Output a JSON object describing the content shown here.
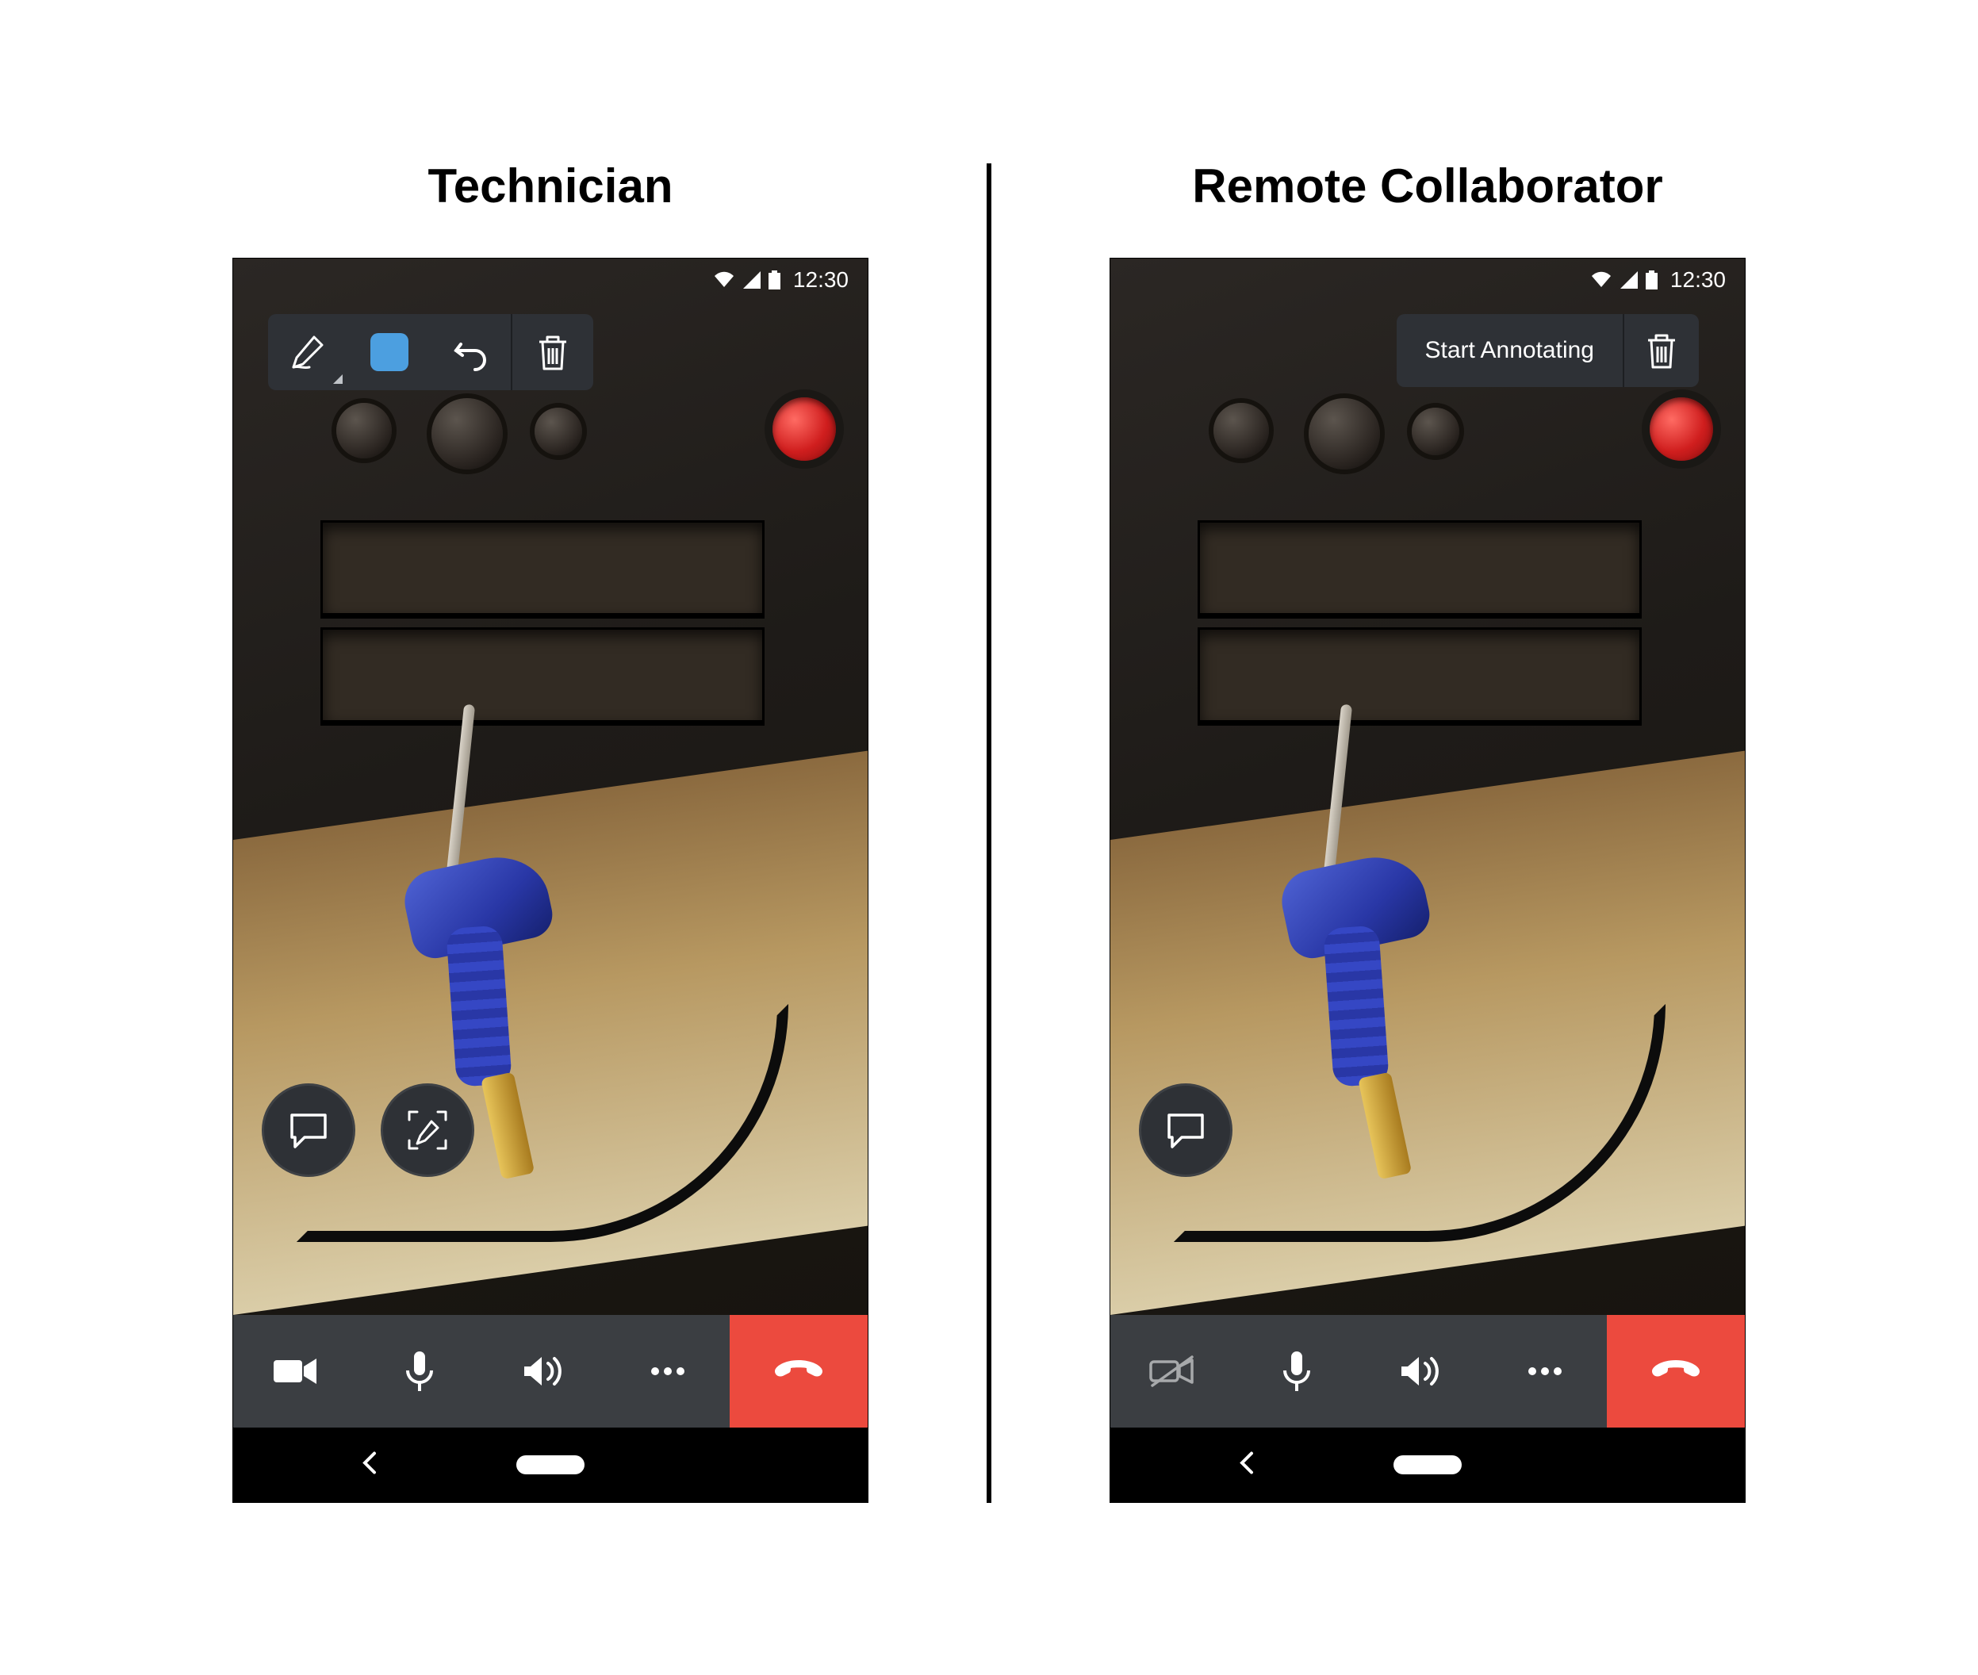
{
  "panels": {
    "technician": {
      "title": "Technician"
    },
    "collaborator": {
      "title": "Remote Collaborator"
    }
  },
  "status": {
    "time": "12:30"
  },
  "collaborator_toolbar": {
    "start_annotating": "Start Annotating"
  },
  "icons": {
    "pen": "pen-icon",
    "color": "color-picker-icon",
    "undo": "undo-icon",
    "trash": "trash-icon",
    "chat": "chat-icon",
    "annotate_view": "annotate-view-icon",
    "camera_on": "video-on-icon",
    "camera_off": "video-off-icon",
    "mic": "microphone-icon",
    "speaker": "speaker-icon",
    "more": "more-icon",
    "hangup": "hangup-icon",
    "wifi": "wifi-icon",
    "signal": "signal-icon",
    "battery": "battery-icon",
    "back": "back-icon",
    "home": "home-pill"
  },
  "colors": {
    "annotation_color": "#4c9fe0",
    "hangup": "#ec4a3e",
    "toolbar": "#2e3136",
    "callbar": "#3b3e42"
  }
}
